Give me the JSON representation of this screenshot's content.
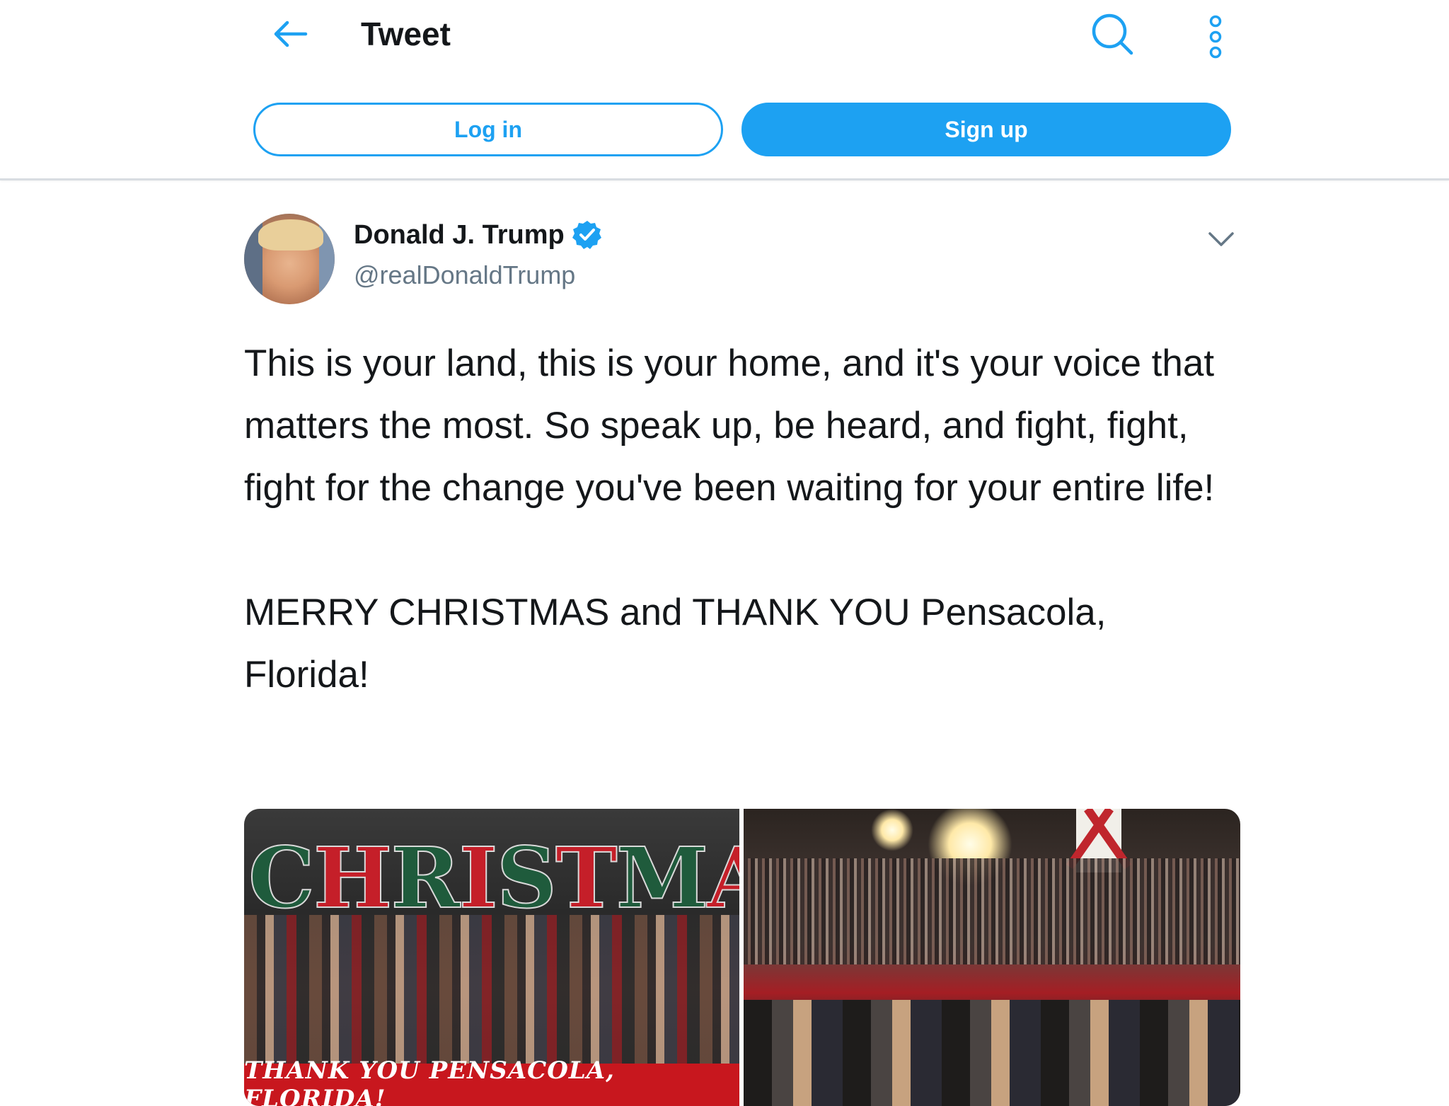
{
  "header": {
    "title": "Tweet",
    "back_icon": "arrow-left-icon",
    "search_icon": "search-icon",
    "more_icon": "more-vertical-icon",
    "accent_color": "#1da1f2"
  },
  "auth": {
    "login_label": "Log in",
    "signup_label": "Sign up"
  },
  "tweet": {
    "author_name": "Donald J. Trump",
    "author_handle": "@realDonaldTrump",
    "verified_icon": "verified-badge-icon",
    "caret_icon": "chevron-down-icon",
    "text": "This is your land, this is your home, and it's your voice that matters the most. So speak up, be heard, and fight, fight, fight for the change you've been waiting for your entire life!\n\nMERRY CHRISTMAS and THANK YOU Pensacola, Florida!",
    "media": {
      "left_banner": "THANK YOU PENSACOLA, FLORIDA!",
      "left_letters": "CHRISTMAS"
    }
  }
}
